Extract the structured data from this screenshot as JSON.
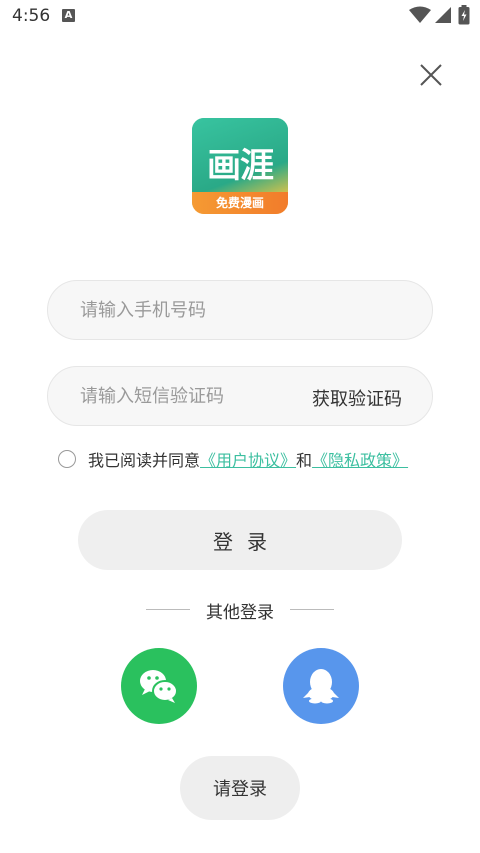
{
  "status_bar": {
    "time": "4:56",
    "notification_letter": "A",
    "icons": [
      "wifi-icon",
      "cell-signal-icon",
      "battery-icon"
    ]
  },
  "close": {
    "icon": "close-icon"
  },
  "logo": {
    "title": "画涯",
    "banner": "免费漫画",
    "colors": {
      "green": "#35b993",
      "orange": "#f38a2f"
    }
  },
  "form": {
    "phone_placeholder": "请输入手机号码",
    "code_placeholder": "请输入短信验证码",
    "get_code_label": "获取验证码"
  },
  "agreement": {
    "prefix": "我已阅读并同意",
    "user_agreement": "《用户协议》",
    "conjunction": "和",
    "privacy_policy": "《隐私政策》",
    "link_color": "#3cbfa0"
  },
  "login_button": "登录",
  "other_login": {
    "label": "其他登录",
    "providers": [
      {
        "icon": "wechat-icon",
        "color": "#2ac15e"
      },
      {
        "icon": "qq-icon",
        "color": "#5896ec"
      }
    ]
  },
  "please_login_button": "请登录"
}
